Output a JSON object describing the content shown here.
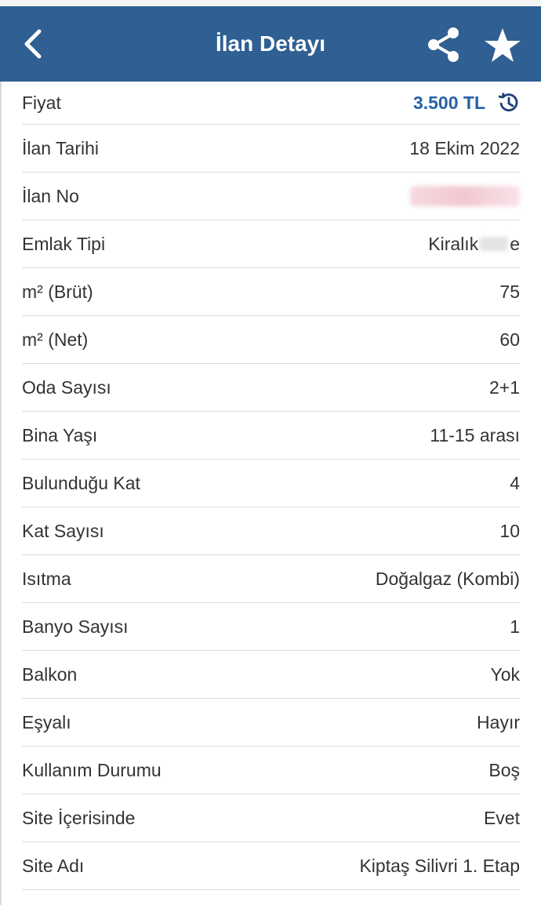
{
  "header": {
    "title": "İlan Detayı",
    "back_icon": "chevron-left-icon",
    "share_icon": "share-icon",
    "favorite_icon": "star-icon",
    "background_color": "#2f5f93"
  },
  "price": {
    "label": "Fiyat",
    "value": "3.500 TL",
    "color": "#2462a6",
    "history_icon": "history-icon"
  },
  "rows": [
    {
      "label": "İlan Tarihi",
      "value": "18 Ekim 2022"
    },
    {
      "label": "İlan No",
      "value": ""
    },
    {
      "label": "Emlak Tipi",
      "value_prefix": "Kiralık",
      "value_suffix": "e"
    },
    {
      "label": "m² (Brüt)",
      "value": "75"
    },
    {
      "label": "m² (Net)",
      "value": "60"
    },
    {
      "label": "Oda Sayısı",
      "value": "2+1"
    },
    {
      "label": "Bina Yaşı",
      "value": "11-15 arası"
    },
    {
      "label": "Bulunduğu Kat",
      "value": "4"
    },
    {
      "label": "Kat Sayısı",
      "value": "10"
    },
    {
      "label": "Isıtma",
      "value": "Doğalgaz (Kombi)"
    },
    {
      "label": "Banyo Sayısı",
      "value": "1"
    },
    {
      "label": "Balkon",
      "value": "Yok"
    },
    {
      "label": "Eşyalı",
      "value": "Hayır"
    },
    {
      "label": "Kullanım Durumu",
      "value": "Boş"
    },
    {
      "label": "Site İçerisinde",
      "value": "Evet"
    },
    {
      "label": "Site Adı",
      "value": "Kiptaş Silivri 1. Etap"
    }
  ]
}
